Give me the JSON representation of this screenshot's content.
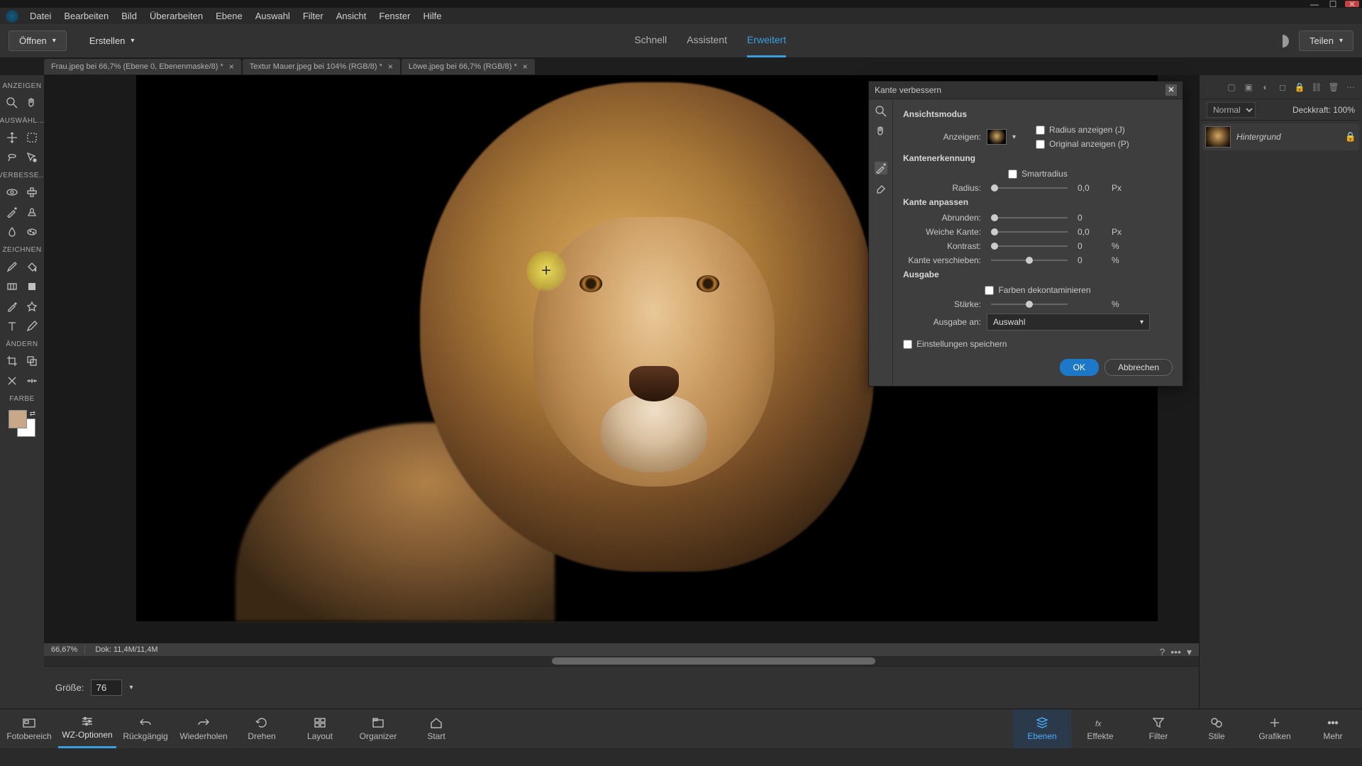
{
  "menu": [
    "Datei",
    "Bearbeiten",
    "Bild",
    "Überarbeiten",
    "Ebene",
    "Auswahl",
    "Filter",
    "Ansicht",
    "Fenster",
    "Hilfe"
  ],
  "toolbar": {
    "open": "Öffnen",
    "create": "Erstellen",
    "share": "Teilen"
  },
  "modes": {
    "quick": "Schnell",
    "guided": "Assistent",
    "expert": "Erweitert"
  },
  "tabs": [
    "Frau.jpeg bei 66,7% (Ebene 0, Ebenenmaske/8) *",
    "Textur Mauer.jpeg bei 104% (RGB/8) *",
    "Löwe.jpeg bei 66,7% (RGB/8) *"
  ],
  "toolSections": {
    "view": "ANZEIGEN",
    "select": "AUSWÄHL...",
    "enhance": "VERBESSE...",
    "draw": "ZEICHNEN",
    "modify": "ÄNDERN",
    "color": "FARBE"
  },
  "status": {
    "zoom": "66,67%",
    "doc": "Dok: 11,4M/11,4M"
  },
  "options": {
    "sizeLabel": "Größe:",
    "size": "76"
  },
  "layerPanel": {
    "blendMode": "Normal",
    "opacityLabel": "Deckkraft:",
    "opacity": "100%",
    "layerName": "Hintergrund"
  },
  "dialog": {
    "title": "Kante verbessern",
    "viewMode": "Ansichtsmodus",
    "showLabel": "Anzeigen:",
    "showRadius": "Radius anzeigen (J)",
    "showOriginal": "Original anzeigen (P)",
    "edgeDetect": "Kantenerkennung",
    "smartRadius": "Smartradius",
    "radiusLabel": "Radius:",
    "radiusVal": "0,0",
    "adjustEdge": "Kante anpassen",
    "smoothLabel": "Abrunden:",
    "smoothVal": "0",
    "featherLabel": "Weiche Kante:",
    "featherVal": "0,0",
    "contrastLabel": "Kontrast:",
    "contrastVal": "0",
    "shiftLabel": "Kante verschieben:",
    "shiftVal": "0",
    "output": "Ausgabe",
    "decontaminate": "Farben dekontaminieren",
    "amountLabel": "Stärke:",
    "outputTo": "Ausgabe an:",
    "outputSel": "Auswahl",
    "remember": "Einstellungen speichern",
    "ok": "OK",
    "cancel": "Abbrechen",
    "px": "Px",
    "pct": "%"
  },
  "bottom": {
    "photobin": "Fotobereich",
    "toolopt": "WZ-Optionen",
    "undo": "Rückgängig",
    "redo": "Wiederholen",
    "rotate": "Drehen",
    "layout": "Layout",
    "organizer": "Organizer",
    "home": "Start",
    "layers": "Ebenen",
    "effects": "Effekte",
    "filters": "Filter",
    "styles": "Stile",
    "graphics": "Grafiken",
    "more": "Mehr"
  }
}
